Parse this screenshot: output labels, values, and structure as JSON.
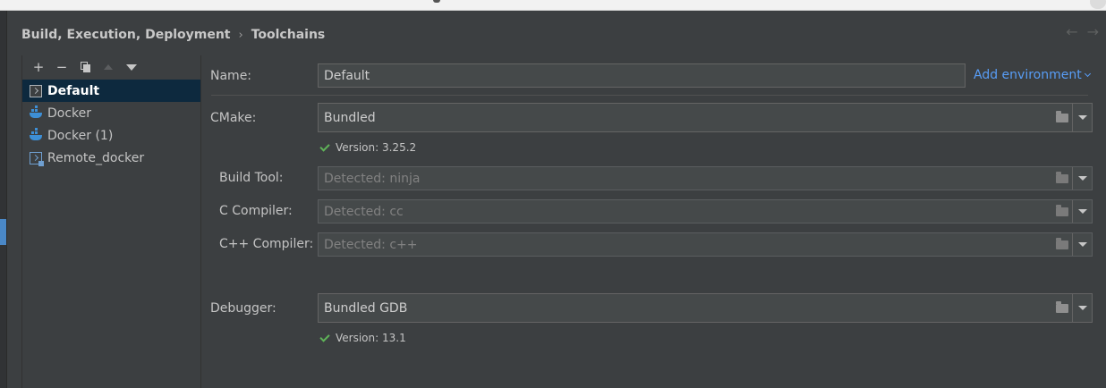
{
  "breadcrumb": {
    "parent": "Build, Execution, Deployment",
    "separator": "›",
    "current": "Toolchains"
  },
  "nav": {
    "back": "←",
    "forward": "→"
  },
  "toolbar": {
    "add": "+",
    "remove": "−"
  },
  "toolchains": [
    {
      "label": "Default",
      "icon": "terminal-icon",
      "selected": true
    },
    {
      "label": "Docker",
      "icon": "docker-icon"
    },
    {
      "label": "Docker (1)",
      "icon": "docker-icon"
    },
    {
      "label": "Remote_docker",
      "icon": "remote-icon"
    }
  ],
  "form": {
    "name_label": "Name:",
    "name_value": "Default",
    "add_environment": "Add environment",
    "cmake_label": "CMake:",
    "cmake_value": "Bundled",
    "cmake_version": "Version: 3.25.2",
    "build_tool_label": "Build Tool:",
    "build_tool_value": "Detected: ninja",
    "c_compiler_label": "C Compiler:",
    "c_compiler_value": "Detected: cc",
    "cpp_compiler_label": "C++ Compiler:",
    "cpp_compiler_value": "Detected: c++",
    "debugger_label": "Debugger:",
    "debugger_value": "Bundled GDB",
    "debugger_version": "Version: 13.1"
  },
  "colors": {
    "background": "#3c3f41",
    "selection": "#0d293e",
    "link": "#589df6",
    "check": "#5fb358"
  }
}
